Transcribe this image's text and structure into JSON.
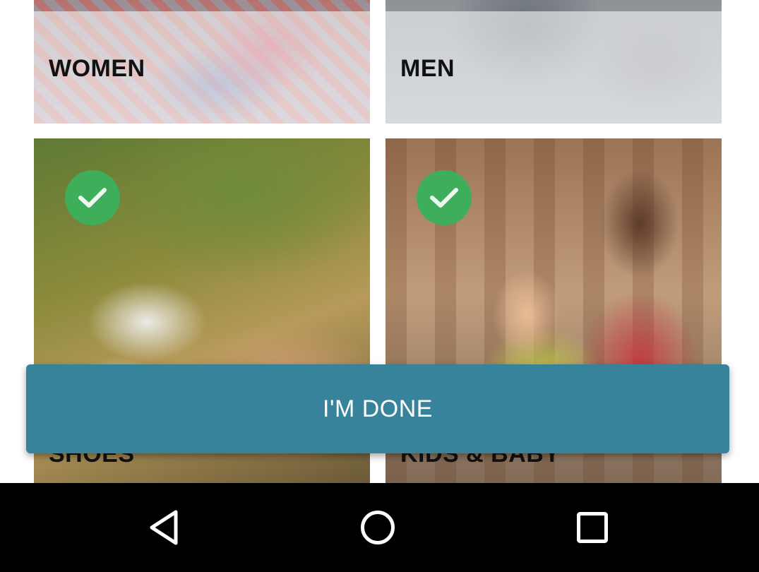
{
  "categories": [
    {
      "id": "women",
      "label": "WOMEN",
      "selected": false
    },
    {
      "id": "men",
      "label": "MEN",
      "selected": false
    },
    {
      "id": "shoes",
      "label": "SHOES",
      "selected": true
    },
    {
      "id": "kids",
      "label": "KIDS & BABY",
      "selected": true
    }
  ],
  "done_button": {
    "label": "I'M DONE"
  },
  "navbar": {
    "icons": [
      "back-icon",
      "home-icon",
      "recents-icon"
    ]
  },
  "colors": {
    "button": "#38839c",
    "check": "#3fae5a",
    "navbar": "#000000"
  }
}
